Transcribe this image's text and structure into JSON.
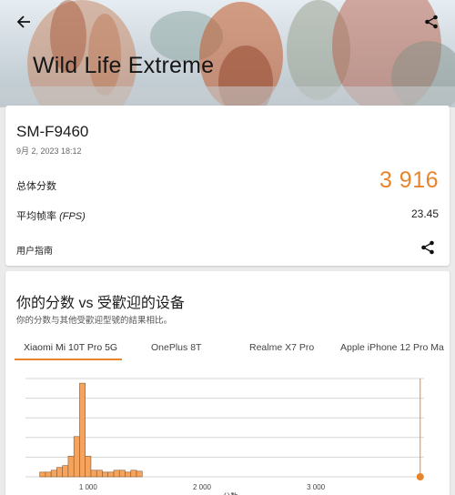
{
  "header": {
    "title": "Wild Life Extreme",
    "back_icon": "arrow-left-icon",
    "share_icon": "share-icon"
  },
  "result": {
    "device": "SM-F9460",
    "datetime": "9月 2, 2023 18:12",
    "score_label": "总体分数",
    "score_value": "3 916",
    "fps_label_prefix": "平均帧率 ",
    "fps_label_unit": "(FPS)",
    "fps_value": "23.45",
    "guide_label": "用户指南"
  },
  "compare": {
    "title": "你的分数 vs 受歡迎的设备",
    "subtitle": "你的分数与其他受歡迎型號的結果相比。",
    "tabs": [
      {
        "label": "Xiaomi Mi 10T Pro 5G",
        "active": true
      },
      {
        "label": "OnePlus 8T",
        "active": false
      },
      {
        "label": "Realme X7 Pro",
        "active": false
      },
      {
        "label": "Apple iPhone 12 Pro Ma",
        "active": false
      }
    ]
  },
  "chart_data": {
    "type": "bar",
    "xlabel": "分数",
    "xticks": [
      "1 000",
      "2 000",
      "3 000"
    ],
    "tick_values": [
      1000,
      2000,
      3000
    ],
    "xlim": [
      450,
      3950
    ],
    "bars": [
      {
        "x": 600,
        "y": 0.5
      },
      {
        "x": 650,
        "y": 0.5
      },
      {
        "x": 700,
        "y": 0.7
      },
      {
        "x": 750,
        "y": 1.0
      },
      {
        "x": 800,
        "y": 1.2
      },
      {
        "x": 850,
        "y": 2.2
      },
      {
        "x": 900,
        "y": 4.3
      },
      {
        "x": 950,
        "y": 10
      },
      {
        "x": 1000,
        "y": 2.2
      },
      {
        "x": 1050,
        "y": 0.7
      },
      {
        "x": 1100,
        "y": 0.7
      },
      {
        "x": 1150,
        "y": 0.5
      },
      {
        "x": 1200,
        "y": 0.5
      },
      {
        "x": 1250,
        "y": 0.7
      },
      {
        "x": 1300,
        "y": 0.7
      },
      {
        "x": 1350,
        "y": 0.5
      },
      {
        "x": 1400,
        "y": 0.7
      },
      {
        "x": 1450,
        "y": 0.6
      }
    ],
    "ylim": [
      0,
      10.5
    ],
    "your_score": 3916,
    "colors": {
      "bar": "#f5a35d",
      "bar_stroke": "#8a5a2e",
      "marker": "#e8852c",
      "grid": "#d6d6d6"
    },
    "grid": true
  }
}
